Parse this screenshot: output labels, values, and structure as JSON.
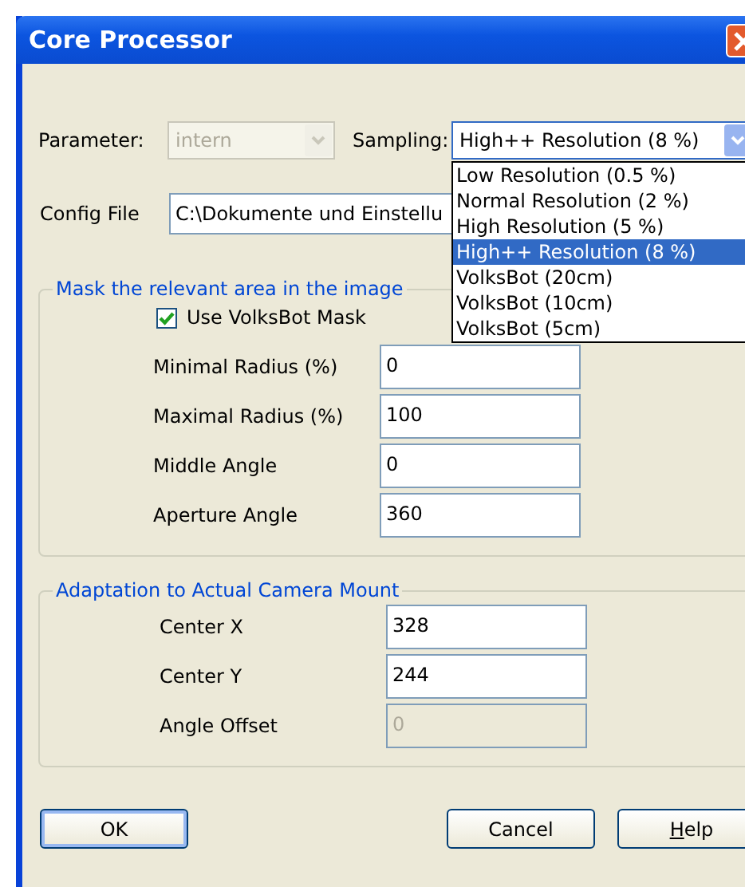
{
  "window": {
    "title": "Core Processor"
  },
  "parameter": {
    "label": "Parameter:",
    "value": "intern",
    "disabled": true
  },
  "sampling": {
    "label": "Sampling:",
    "value": "High++ Resolution (8 %)",
    "expanded": true,
    "options": [
      {
        "label": "Low Resolution (0.5 %)",
        "selected": false
      },
      {
        "label": "Normal Resolution (2 %)",
        "selected": false
      },
      {
        "label": "High Resolution (5 %)",
        "selected": false
      },
      {
        "label": "High++ Resolution (8 %)",
        "selected": true
      },
      {
        "label": "VolksBot (20cm)",
        "selected": false
      },
      {
        "label": "VolksBot (10cm)",
        "selected": false
      },
      {
        "label": "VolksBot (5cm)",
        "selected": false
      }
    ]
  },
  "config_file": {
    "label": "Config File",
    "value": "C:\\Dokumente und Einstellu"
  },
  "mask_group": {
    "title": "Mask the relevant area in the image",
    "checkbox": {
      "label": "Use VolksBot Mask",
      "checked": true
    },
    "fields": [
      {
        "label": "Minimal Radius (%)",
        "value": "0",
        "disabled": false
      },
      {
        "label": "Maximal Radius (%)",
        "value": "100",
        "disabled": false
      },
      {
        "label": "Middle Angle",
        "value": "0",
        "disabled": false
      },
      {
        "label": "Aperture Angle",
        "value": "360",
        "disabled": false
      }
    ]
  },
  "camera_group": {
    "title": "Adaptation to Actual Camera Mount",
    "fields": [
      {
        "label": "Center X",
        "value": "328",
        "disabled": false
      },
      {
        "label": "Center Y",
        "value": "244",
        "disabled": false
      },
      {
        "label": "Angle Offset",
        "value": "0",
        "disabled": true
      }
    ]
  },
  "buttons": [
    {
      "label": "OK",
      "default": true
    },
    {
      "label": "Cancel",
      "default": false
    },
    {
      "label": "Help",
      "default": false,
      "mnemonic_first": true
    }
  ]
}
